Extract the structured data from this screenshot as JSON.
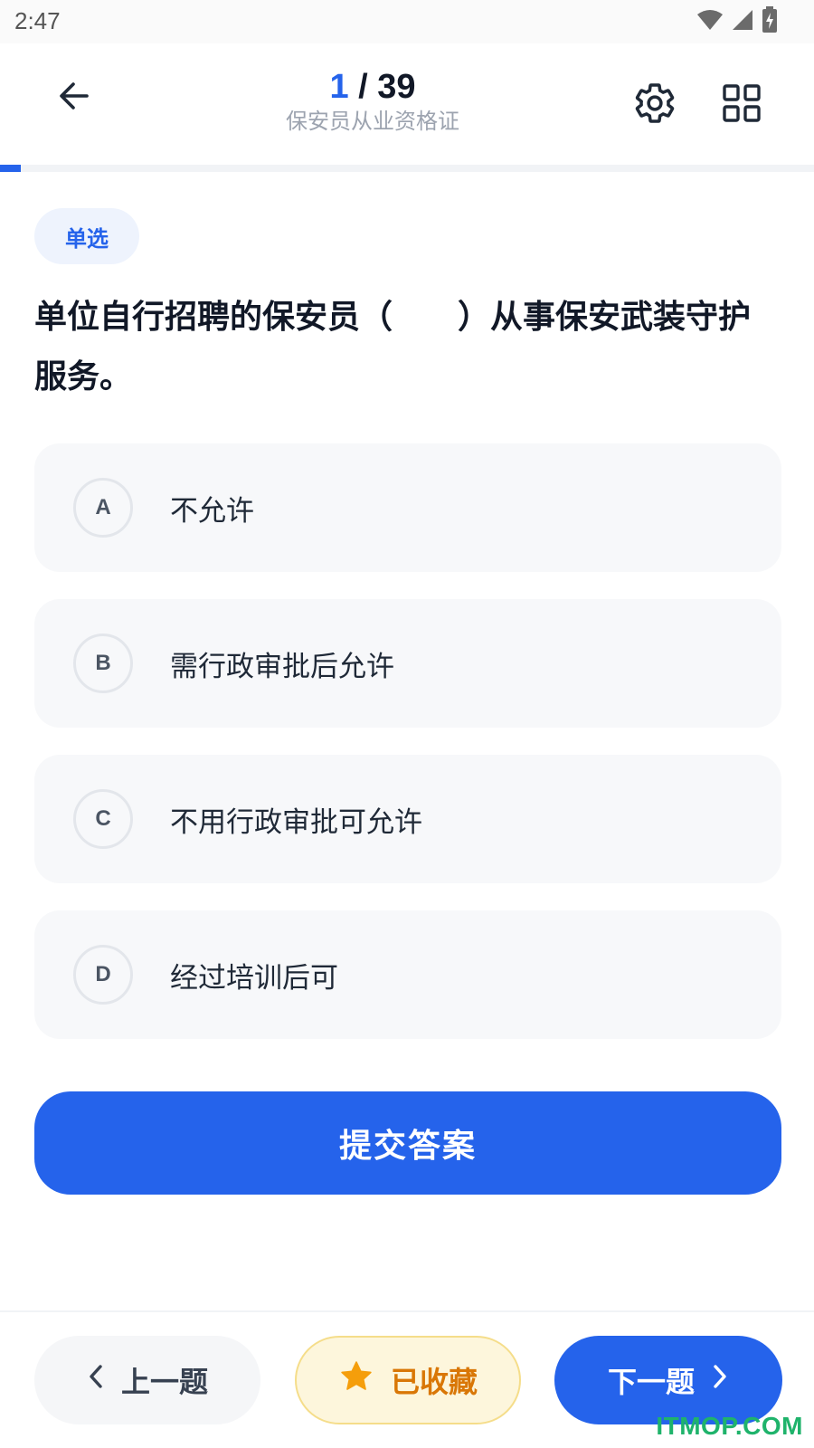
{
  "status_bar": {
    "time": "2:47",
    "icons": [
      "wifi-icon",
      "cell-signal-icon",
      "battery-charging-icon"
    ]
  },
  "header": {
    "progress_current": "1",
    "progress_separator": " / ",
    "progress_total": "39",
    "subtitle": "保安员从业资格证",
    "icons": [
      "back-arrow-icon",
      "gear-icon",
      "grid-icon"
    ]
  },
  "progress": {
    "fraction": 0.0256
  },
  "question": {
    "type_label": "单选",
    "text": "单位自行招聘的保安员（　　）从事保安武装守护服务。",
    "options": [
      {
        "letter": "A",
        "text": "不允许"
      },
      {
        "letter": "B",
        "text": "需行政审批后允许"
      },
      {
        "letter": "C",
        "text": "不用行政审批可允许"
      },
      {
        "letter": "D",
        "text": "经过培训后可"
      }
    ]
  },
  "submit_label": "提交答案",
  "bottom": {
    "prev_label": "上一题",
    "favorite_label": "已收藏",
    "next_label": "下一题",
    "icons": [
      "chevron-left-icon",
      "star-icon",
      "chevron-right-icon"
    ]
  },
  "watermark": "ITMOP.COM",
  "colors": {
    "primary": "#2563eb",
    "favorite": "#d97706",
    "favorite_bg": "#fdf6dc",
    "option_bg": "#f7f8fa",
    "watermark": "#1fb36b"
  }
}
